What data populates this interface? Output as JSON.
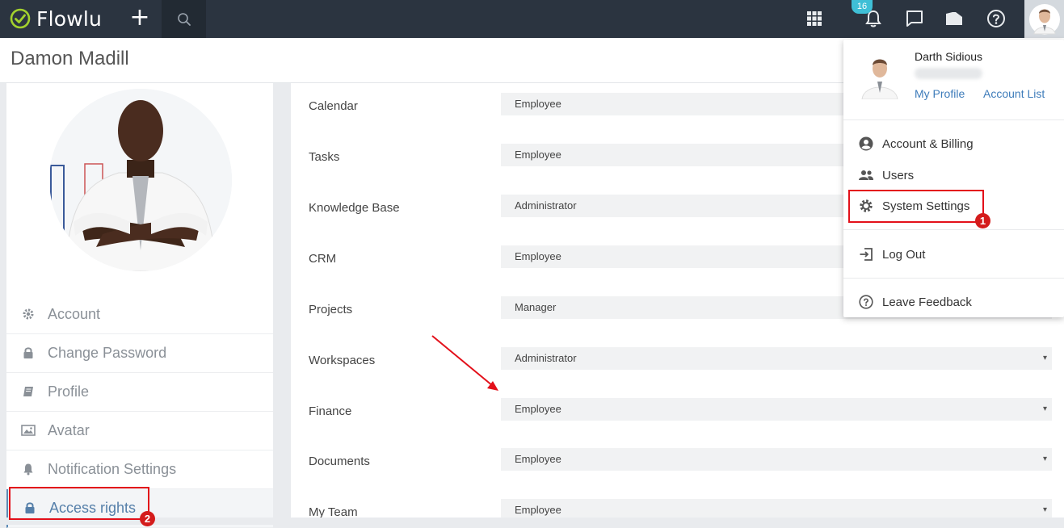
{
  "topbar": {
    "brand": "Flowlu",
    "notification_count": "16",
    "icons": [
      "plus-icon",
      "search-icon",
      "apps-grid-icon",
      "bell-icon",
      "chat-icon",
      "folder-icon",
      "help-icon"
    ]
  },
  "page": {
    "title": "Damon Madill"
  },
  "sidebar": {
    "items": [
      {
        "label": "Account",
        "icon": "gear-icon"
      },
      {
        "label": "Change Password",
        "icon": "lock-icon"
      },
      {
        "label": "Profile",
        "icon": "book-icon"
      },
      {
        "label": "Avatar",
        "icon": "image-icon"
      },
      {
        "label": "Notification Settings",
        "icon": "bell-icon"
      },
      {
        "label": "Access rights",
        "icon": "lock-icon",
        "active": true
      }
    ]
  },
  "access_rights": {
    "rows": [
      {
        "label": "Calendar",
        "value": "Employee"
      },
      {
        "label": "Tasks",
        "value": "Employee"
      },
      {
        "label": "Knowledge Base",
        "value": "Administrator"
      },
      {
        "label": "CRM",
        "value": "Employee"
      },
      {
        "label": "Projects",
        "value": "Manager"
      },
      {
        "label": "Workspaces",
        "value": "Administrator"
      },
      {
        "label": "Finance",
        "value": "Employee"
      },
      {
        "label": "Documents",
        "value": "Employee"
      },
      {
        "label": "My Team",
        "value": "Employee"
      }
    ],
    "caret": "▾"
  },
  "user_menu": {
    "name": "Darth Sidious",
    "my_profile": "My Profile",
    "account_list": "Account List",
    "items": [
      {
        "label": "Account & Billing",
        "icon": "account-circle-icon"
      },
      {
        "label": "Users",
        "icon": "users-icon"
      },
      {
        "label": "System Settings",
        "icon": "gear-icon"
      },
      {
        "label": "Log Out",
        "icon": "logout-icon"
      },
      {
        "label": "Leave Feedback",
        "icon": "help-icon"
      }
    ]
  },
  "annotations": {
    "marker1": "1",
    "marker2": "2",
    "color": "#e3101a"
  },
  "colors": {
    "topbar": "#2b3440",
    "logo_check": "#a3d12d",
    "link": "#3e7cba",
    "badge": "#3fbfd6"
  }
}
